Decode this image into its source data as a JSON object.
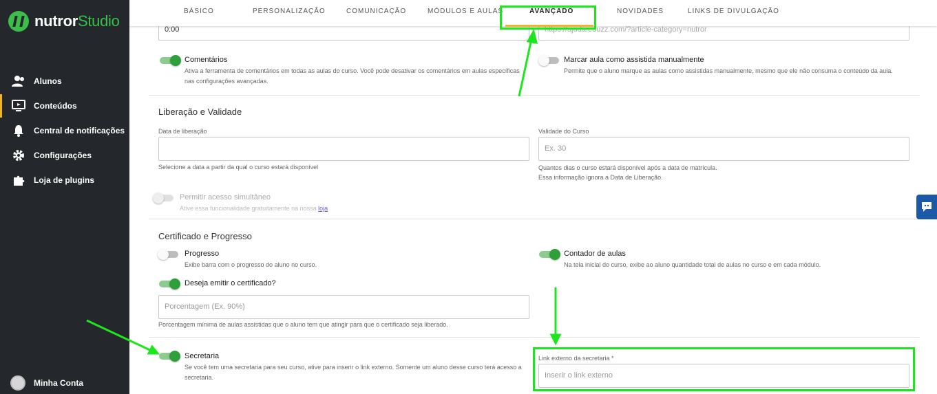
{
  "brand": {
    "name": "nutror",
    "suffix": "Studio",
    "accent": "#3cbf4a"
  },
  "sidebar": {
    "items": [
      {
        "label": "Alunos",
        "icon": "users-icon"
      },
      {
        "label": "Conteúdos",
        "icon": "monitor-icon",
        "active": true
      },
      {
        "label": "Central de notificações",
        "icon": "bell-icon"
      },
      {
        "label": "Configurações",
        "icon": "gear-icon"
      },
      {
        "label": "Loja de plugins",
        "icon": "puzzle-icon"
      }
    ],
    "account": "Minha Conta"
  },
  "tabs": [
    {
      "label": "BÁSICO"
    },
    {
      "label": "PERSONALIZAÇÃO"
    },
    {
      "label": "COMUNICAÇÃO"
    },
    {
      "label": "MÓDULOS E AULAS"
    },
    {
      "label": "AVANÇADO",
      "active": true
    },
    {
      "label": "NOVIDADES"
    },
    {
      "label": "LINKS DE DIVULGAÇÃO"
    }
  ],
  "top_fields": {
    "time_value": "0:00",
    "url_value": "https://ajuda.eduzz.com/?article-category=nutror"
  },
  "options": {
    "comments": {
      "title": "Comentários",
      "desc": "Ativa a ferramenta de comentários em todas as aulas do curso. Você pode desativar os comentários em aulas específicas nas configurações avançadas.",
      "state": "on"
    },
    "mark_watched": {
      "title": "Marcar aula como assistida manualmente",
      "desc": "Permite que o aluno marque as aulas como assistidas manualmente, mesmo que ele não consuma o conteúdo da aula.",
      "state": "off"
    }
  },
  "release": {
    "section_title": "Liberação e Validade",
    "release_date_label": "Data de liberação",
    "release_date_help": "Selecione a data a partir da qual o curso estará disponível",
    "validity_label": "Validade do Curso",
    "validity_placeholder": "Ex. 30",
    "validity_help_1": "Quantos dias o curso estará disponível após a data de matrícula.",
    "validity_help_2": "Essa informação ignora a Data de Liberação.",
    "simultaneous_title": "Permitir acesso simultâneo",
    "simultaneous_desc": "Ative essa funcionalidade gratuitamente na nossa",
    "simultaneous_link": "loja"
  },
  "certificate": {
    "section_title": "Certificado e Progresso",
    "progress_title": "Progresso",
    "progress_desc": "Exibe barra com o progresso do aluno no curso.",
    "counter_title": "Contador de aulas",
    "counter_desc": "Na tela inicial do curso, exibe ao aluno quantidade total de aulas no curso e em cada módulo.",
    "emit_title": "Deseja emitir o certificado?",
    "percent_placeholder": "Porcentagem (Ex. 90%)",
    "percent_help": "Porcentagem mínima de aulas assistidas que o aluno tem que atingir para que o certificado seja liberado.",
    "secretary_title": "Secretaria",
    "secretary_desc": "Se você tem uma secretaria para seu curso, ative para inserir o link externo. Somente um aluno desse curso terá acesso a secretaria.",
    "secretary_link_label": "Link externo da secretaria *",
    "secretary_link_placeholder": "Inserir o link externo"
  },
  "colors": {
    "toggle_on": "#2e9f3a",
    "tab_active_underline": "#f0b429",
    "annotation": "#1ee61e",
    "sidebar_bg": "#24282c"
  }
}
